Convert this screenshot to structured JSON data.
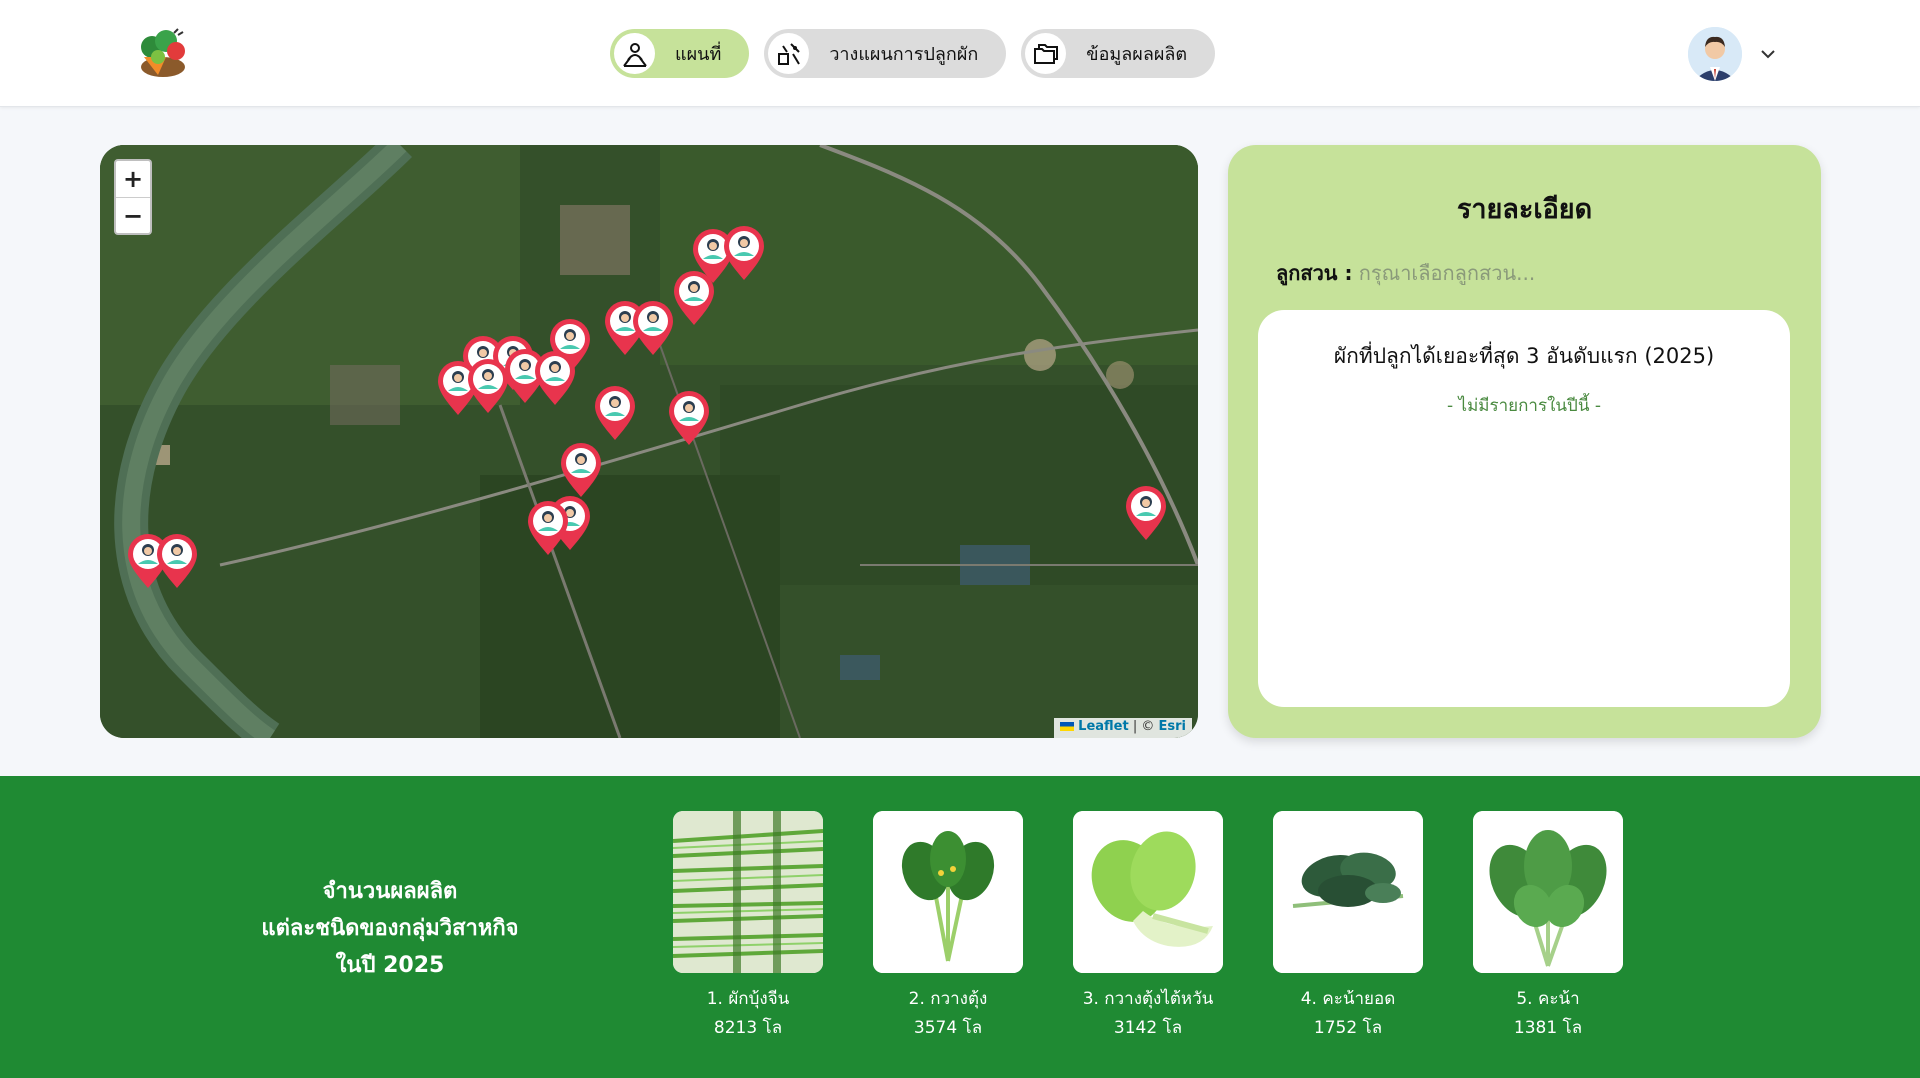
{
  "header": {
    "logo_icon": "vegetable-basket-logo",
    "nav": [
      {
        "label": "แผนที่",
        "icon": "map-pin-person-icon",
        "active": true
      },
      {
        "label": "วางแผนการปลูกผัก",
        "icon": "planting-plan-icon",
        "active": false
      },
      {
        "label": "ข้อมูลผลผลิต",
        "icon": "folders-icon",
        "active": false
      }
    ],
    "user_icon": "user-avatar",
    "menu_icon": "chevron-down-icon"
  },
  "map": {
    "zoom_in": "+",
    "zoom_out": "−",
    "attribution_prefix": "Leaflet",
    "attribution_sep": " | © ",
    "attribution_provider": "Esri"
  },
  "details": {
    "title": "รายละเอียด",
    "farmer_label": "ลูกสวน :",
    "farmer_placeholder": "กรุณาเลือกลูกสวน...",
    "top_title": "ผักที่ปลูกได้เยอะที่สุด 3 อันดับแรก (2025)",
    "top_empty": "- ไม่มีรายการในปีนี้ -"
  },
  "production": {
    "title_lines": [
      "จำนวนผลผลิต",
      "แต่ละชนิดของกลุ่มวิสาหกิจ",
      "ในปี 2025"
    ],
    "items": [
      {
        "name": "1. ผักบุ้งจีน",
        "qty": "8213 โล"
      },
      {
        "name": "2. กวางตุ้ง",
        "qty": "3574 โล"
      },
      {
        "name": "3. กวางตุ้งไต้หวัน",
        "qty": "3142 โล"
      },
      {
        "name": "4. คะน้ายอด",
        "qty": "1752 โล"
      },
      {
        "name": "5. คะน้า",
        "qty": "1381 โล"
      }
    ]
  },
  "colors": {
    "active_pill": "#c6e29a",
    "inactive_pill": "#dcdcdc",
    "band": "#1f8a33",
    "marker": "#e8344d"
  }
}
